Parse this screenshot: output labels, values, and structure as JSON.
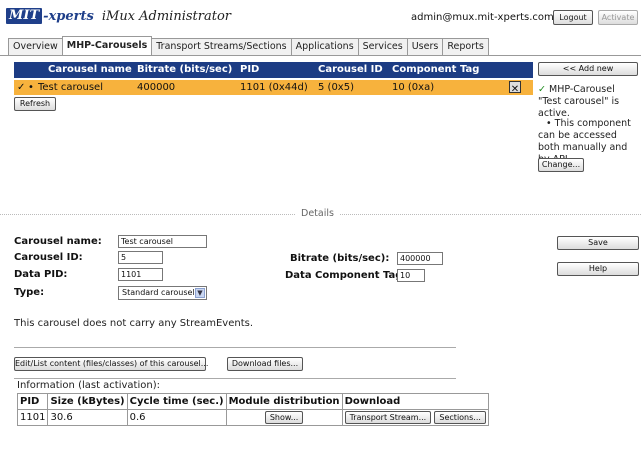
{
  "header": {
    "logo_box": "MIT",
    "logo_rest": "-xperts",
    "app_title": "iMux Administrator",
    "user": "admin@mux.mit-xperts.com",
    "logout_label": "Logout",
    "activate_label": "Activate"
  },
  "tabs": [
    "Overview",
    "MHP-Carousels",
    "Transport Streams/Sections",
    "Applications",
    "Services",
    "Users",
    "Reports"
  ],
  "active_tab": "MHP-Carousels",
  "list": {
    "columns": [
      "Carousel name",
      "Bitrate (bits/sec)",
      "PID",
      "Carousel ID",
      "Component Tag"
    ],
    "rows": [
      {
        "status": "✓",
        "marker": "•",
        "name": "Test carousel",
        "bitrate": "400000",
        "pid": "1101 (0x44d)",
        "carousel_id": "5 (0x5)",
        "component_tag": "10 (0xa)"
      }
    ],
    "refresh_label": "Refresh"
  },
  "side": {
    "add_new_label": "<< Add new",
    "status_check": "✓",
    "status_text": "MHP-Carousel \"Test carousel\" is active.",
    "info_bullet": "•",
    "info_text": "This component can be accessed both manually and by API.",
    "change_label": "Change...",
    "save_label": "Save",
    "help_label": "Help"
  },
  "details": {
    "section_title": "Details",
    "carousel_name_label": "Carousel name:",
    "carousel_name_value": "Test carousel",
    "carousel_id_label": "Carousel ID:",
    "carousel_id_value": "5",
    "data_pid_label": "Data PID:",
    "data_pid_value": "1101",
    "type_label": "Type:",
    "type_value": "Standard carousel",
    "bitrate_label": "Bitrate (bits/sec):",
    "bitrate_value": "400000",
    "component_tag_label": "Data Component Tag:",
    "component_tag_value": "10",
    "stream_events_text": "This carousel does not carry any StreamEvents.",
    "edit_content_label": "Edit/List content (files/classes) of this carousel...",
    "download_files_label": "Download files..."
  },
  "info": {
    "heading": "Information (last activation):",
    "columns": [
      "PID",
      "Size (kBytes)",
      "Cycle time (sec.)",
      "Module distribution",
      "Download"
    ],
    "pid": "1101",
    "size": "30.6",
    "cycle_time": "0.6",
    "show_label": "Show...",
    "transport_stream_label": "Transport Stream...",
    "sections_label": "Sections..."
  },
  "colors": {
    "header_blue": "#1c3c84",
    "selected_row": "#f7b23d",
    "active_check": "#1a8a1a"
  }
}
